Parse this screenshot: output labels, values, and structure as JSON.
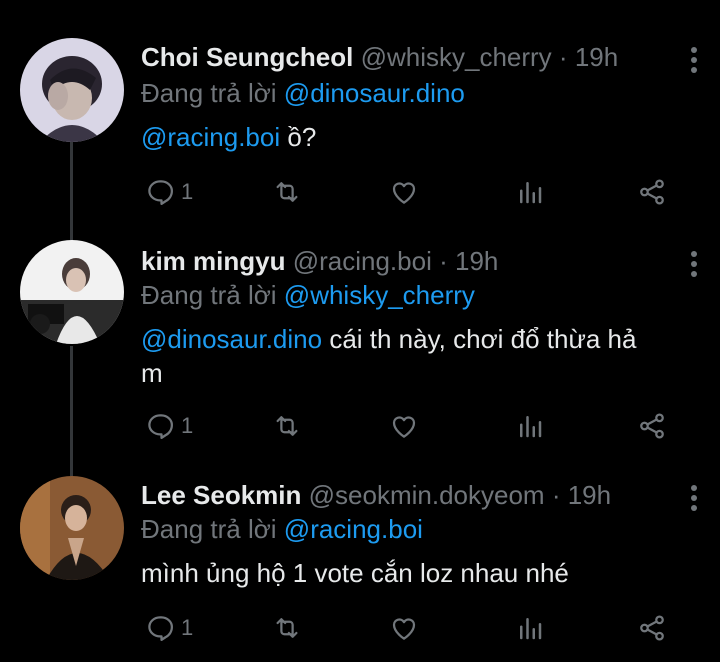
{
  "tweets": [
    {
      "name": "Choi Seungcheol",
      "handle": "@whisky_cherry",
      "separator": "·",
      "time": "19h",
      "reply_prefix": "Đang trả lời",
      "reply_to": "@dinosaur.dino",
      "mention": "@racing.boi",
      "text": "ồ?",
      "reply_count": "1"
    },
    {
      "name": "kim mingyu",
      "handle": "@racing.boi",
      "separator": "·",
      "time": "19h",
      "reply_prefix": "Đang trả lời",
      "reply_to": "@whisky_cherry",
      "mention": "@dinosaur.dino",
      "text": "cái th này, chơi đổ thừa hả m",
      "reply_count": "1"
    },
    {
      "name": "Lee Seokmin",
      "handle": "@seokmin.dokyeom",
      "separator": "·",
      "time": "19h",
      "reply_prefix": "Đang trả lời",
      "reply_to": "@racing.boi",
      "mention": "",
      "text": "mình ủng hộ 1 vote cắn loz nhau nhé",
      "reply_count": "1"
    }
  ],
  "colors": {
    "background": "#000000",
    "primary_text": "#e7e9ea",
    "secondary_text": "#71767b",
    "link": "#1d9bf0"
  },
  "icons": [
    "reply-icon",
    "retweet-icon",
    "like-icon",
    "views-icon",
    "share-icon",
    "more-icon"
  ]
}
